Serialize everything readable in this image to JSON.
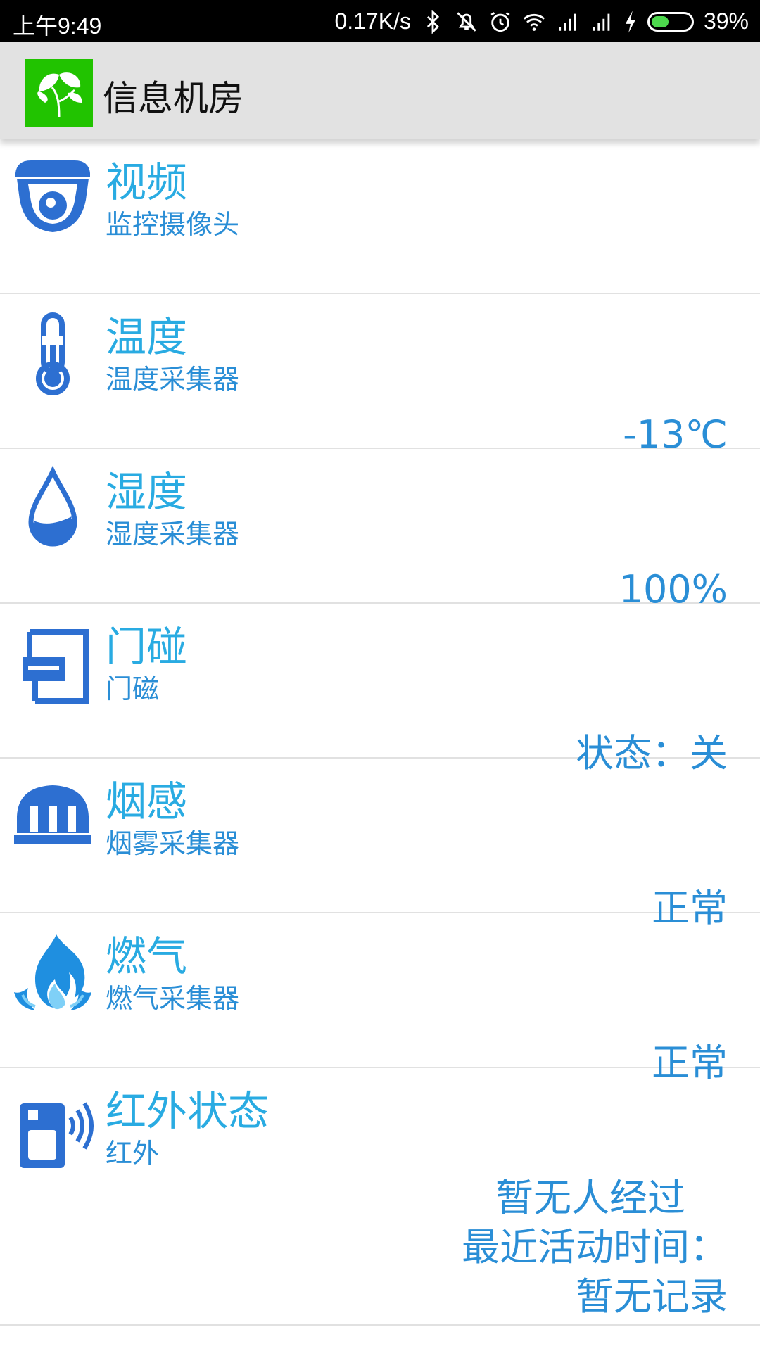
{
  "status_bar": {
    "time": "上午9:49",
    "net_speed": "0.17K/s",
    "battery_pct": "39%",
    "battery_level": 0.39,
    "icons": [
      "bluetooth-icon",
      "mute-icon",
      "alarm-icon",
      "wifi-icon",
      "signal-icon",
      "signal-icon",
      "charging-icon",
      "battery-icon"
    ]
  },
  "app_bar": {
    "title": "信息机房",
    "logo_icon": "ginkgo-leaf-icon",
    "logo_color": "#21c300"
  },
  "colors": {
    "title_blue": "#29abe2",
    "text_blue": "#2a8ed6",
    "icon_blue": "#2d6fd1"
  },
  "items": [
    {
      "icon": "camera-icon",
      "name": "视频",
      "sub": "监控摄像头",
      "value": ""
    },
    {
      "icon": "thermometer-icon",
      "name": "温度",
      "sub": "温度采集器",
      "value": "-13℃"
    },
    {
      "icon": "water-drop-icon",
      "name": "湿度",
      "sub": "湿度采集器",
      "value": "100%"
    },
    {
      "icon": "door-sensor-icon",
      "name": "门碰",
      "sub": "门磁",
      "value": "状态：关"
    },
    {
      "icon": "smoke-detector-icon",
      "name": "烟感",
      "sub": "烟雾采集器",
      "value": "正常"
    },
    {
      "icon": "gas-flame-icon",
      "name": "燃气",
      "sub": "燃气采集器",
      "value": "正常"
    },
    {
      "icon": "infrared-sensor-icon",
      "name": "红外状态",
      "sub": "红外",
      "value_lines": [
        "暂无人经过",
        "最近活动时间：",
        "暂无记录"
      ]
    }
  ]
}
